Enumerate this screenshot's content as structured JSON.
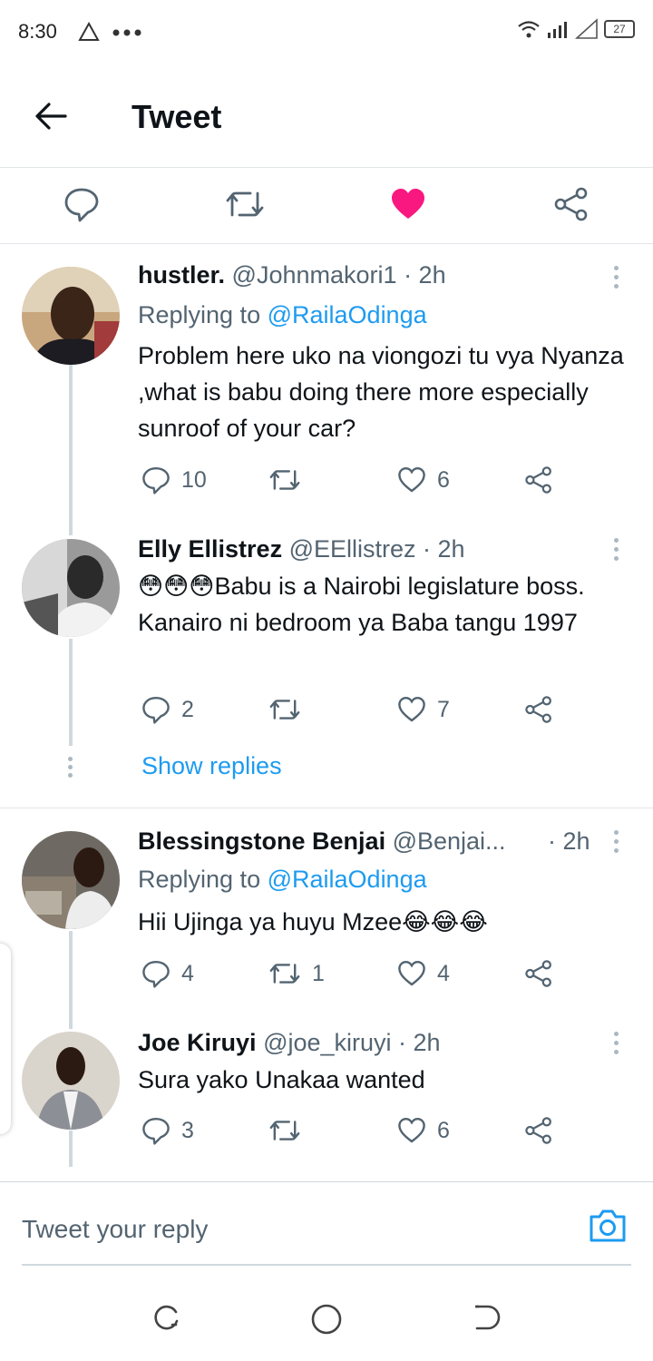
{
  "status_bar": {
    "time": "8:30",
    "battery": "27"
  },
  "header": {
    "title": "Tweet"
  },
  "colors": {
    "like": "#f91880",
    "link": "#1d9bf0",
    "muted": "#536471"
  },
  "tweets": [
    {
      "display_name": "hustler.",
      "handle": "@Johnmakori1",
      "time": "· 2h",
      "replying_label": "Replying to",
      "replying_to": "@RailaOdinga",
      "text": "Problem here uko na viongozi tu vya Nyanza ,what is babu doing there more especially sunroof of your car?",
      "replies": "10",
      "retweets": "",
      "likes": "6"
    },
    {
      "display_name": "Elly Ellistrez",
      "handle": "@EEllistrez",
      "time": "· 2h",
      "text": "😳😳😳Babu is a Nairobi legislature boss. Kanairo ni bedroom ya Baba tangu 1997",
      "replies": "2",
      "retweets": "",
      "likes": "7"
    },
    {
      "display_name": "Blessingstone Benjai",
      "handle": "@Benjai...",
      "time": "· 2h",
      "replying_label": "Replying to",
      "replying_to": "@RailaOdinga",
      "text": "Hii Ujinga ya huyu Mzee😂😂😂",
      "replies": "4",
      "retweets": "1",
      "likes": "4"
    },
    {
      "display_name": "Joe Kiruyi",
      "handle": "@joe_kiruyi",
      "time": "· 2h",
      "text": "Sura yako Unakaa wanted",
      "replies": "3",
      "retweets": "",
      "likes": "6"
    }
  ],
  "show_replies_label": "Show replies",
  "reply_bar": {
    "placeholder": "Tweet your reply"
  }
}
